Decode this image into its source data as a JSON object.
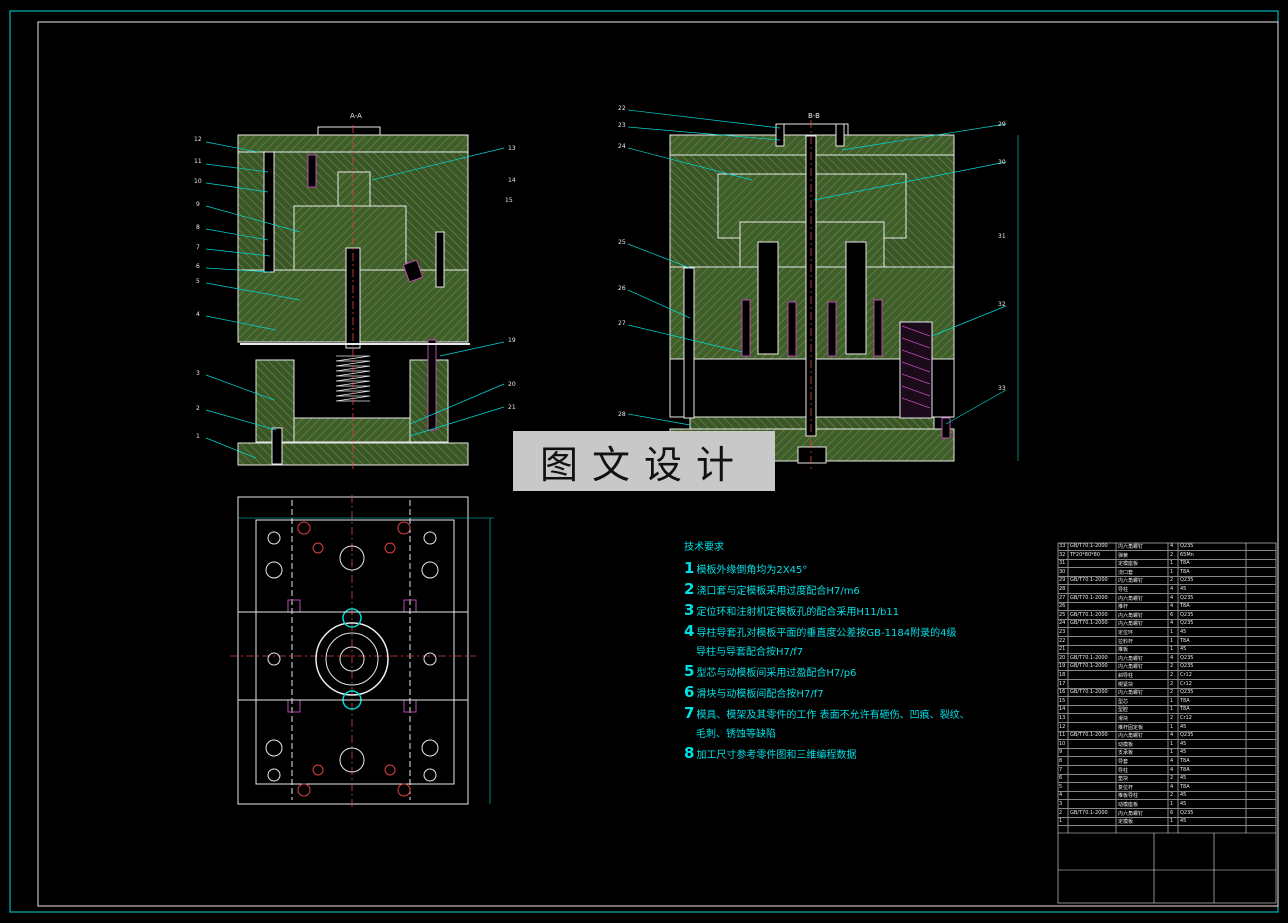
{
  "views": {
    "section_aa_title": "A-A",
    "section_bb_title": "B-B"
  },
  "left_callouts": [
    "12",
    "11",
    "10",
    "9",
    "8",
    "7",
    "6",
    "5",
    "4",
    "3",
    "2",
    "1",
    "13",
    "14",
    "15",
    "19",
    "20",
    "21"
  ],
  "right_callouts": [
    "22",
    "23",
    "24",
    "25",
    "26",
    "27",
    "28",
    "29",
    "30",
    "31",
    "32",
    "33"
  ],
  "watermark": "图文设计",
  "technical_requirements": {
    "title": "技术要求",
    "items": [
      {
        "num": "1",
        "text": "模板外缘倒角均为2X45°"
      },
      {
        "num": "2",
        "text": "浇口套与定模板采用过度配合H7/m6"
      },
      {
        "num": "3",
        "text": "定位环和注射机定模板孔的配合采用H11/b11"
      },
      {
        "num": "4",
        "text": "导柱导套孔对模板平面的垂直度公差按GB-1184附录的4级"
      },
      {
        "num": "",
        "text": "导柱与导套配合按H7/f7"
      },
      {
        "num": "5",
        "text": "型芯与动模板间采用过盈配合H7/p6"
      },
      {
        "num": "6",
        "text": "滑块与动模板间配合按H7/f7"
      },
      {
        "num": "7",
        "text": "模具、模架及其零件的工作 表面不允许有砸伤、凹痕、裂纹、"
      },
      {
        "num": "",
        "text": "毛刺、锈蚀等缺陷"
      },
      {
        "num": "8",
        "text": "加工尺寸参考零件图和三维编程数据"
      }
    ]
  },
  "bom": [
    {
      "no": "33",
      "std": "GB/T70.1-2000",
      "name": "内六角螺钉",
      "qty": "4",
      "mat": "Q235"
    },
    {
      "no": "32",
      "std": "TF20*80*80",
      "name": "弹簧",
      "qty": "2",
      "mat": "65Mn"
    },
    {
      "no": "31",
      "std": "",
      "name": "定模座板",
      "qty": "1",
      "mat": "T8A"
    },
    {
      "no": "30",
      "std": "",
      "name": "浇口套",
      "qty": "1",
      "mat": "T8A"
    },
    {
      "no": "29",
      "std": "GB/T70.1-2000",
      "name": "内六角螺钉",
      "qty": "2",
      "mat": "Q235"
    },
    {
      "no": "28",
      "std": "",
      "name": "导柱",
      "qty": "4",
      "mat": "45"
    },
    {
      "no": "27",
      "std": "GB/T70.1-2000",
      "name": "内六角螺钉",
      "qty": "4",
      "mat": "Q235"
    },
    {
      "no": "26",
      "std": "",
      "name": "推杆",
      "qty": "4",
      "mat": "T8A"
    },
    {
      "no": "25",
      "std": "GB/T70.1-2000",
      "name": "内六角螺钉",
      "qty": "6",
      "mat": "Q235"
    },
    {
      "no": "24",
      "std": "GB/T70.1-2000",
      "name": "内六角螺钉",
      "qty": "4",
      "mat": "Q235"
    },
    {
      "no": "23",
      "std": "",
      "name": "定位环",
      "qty": "1",
      "mat": "45"
    },
    {
      "no": "22",
      "std": "",
      "name": "拉料杆",
      "qty": "1",
      "mat": "T8A"
    },
    {
      "no": "21",
      "std": "",
      "name": "推板",
      "qty": "1",
      "mat": "45"
    },
    {
      "no": "20",
      "std": "GB/T70.1-2000",
      "name": "内六角螺钉",
      "qty": "4",
      "mat": "Q235"
    },
    {
      "no": "19",
      "std": "GB/T70.1-2000",
      "name": "内六角螺钉",
      "qty": "2",
      "mat": "Q235"
    },
    {
      "no": "18",
      "std": "",
      "name": "斜导柱",
      "qty": "2",
      "mat": "Cr12"
    },
    {
      "no": "17",
      "std": "",
      "name": "楔紧块",
      "qty": "2",
      "mat": "Cr12"
    },
    {
      "no": "16",
      "std": "GB/T70.1-2000",
      "name": "内六角螺钉",
      "qty": "2",
      "mat": "Q235"
    },
    {
      "no": "15",
      "std": "",
      "name": "型芯",
      "qty": "1",
      "mat": "T8A"
    },
    {
      "no": "14",
      "std": "",
      "name": "型腔",
      "qty": "1",
      "mat": "T8A"
    },
    {
      "no": "13",
      "std": "",
      "name": "滑块",
      "qty": "2",
      "mat": "Cr12"
    },
    {
      "no": "12",
      "std": "",
      "name": "推杆固定板",
      "qty": "1",
      "mat": "45"
    },
    {
      "no": "11",
      "std": "GB/T70.1-2000",
      "name": "内六角螺钉",
      "qty": "4",
      "mat": "Q235"
    },
    {
      "no": "10",
      "std": "",
      "name": "动模板",
      "qty": "1",
      "mat": "45"
    },
    {
      "no": "9",
      "std": "",
      "name": "支承板",
      "qty": "1",
      "mat": "45"
    },
    {
      "no": "8",
      "std": "",
      "name": "导套",
      "qty": "4",
      "mat": "T8A"
    },
    {
      "no": "7",
      "std": "",
      "name": "导柱",
      "qty": "4",
      "mat": "T8A"
    },
    {
      "no": "6",
      "std": "",
      "name": "垫块",
      "qty": "2",
      "mat": "45"
    },
    {
      "no": "5",
      "std": "",
      "name": "复位杆",
      "qty": "4",
      "mat": "T8A"
    },
    {
      "no": "4",
      "std": "",
      "name": "推板导柱",
      "qty": "2",
      "mat": "45"
    },
    {
      "no": "3",
      "std": "",
      "name": "动模座板",
      "qty": "1",
      "mat": "45"
    },
    {
      "no": "2",
      "std": "GB/T70.1-2000",
      "name": "内六角螺钉",
      "qty": "6",
      "mat": "Q235"
    },
    {
      "no": "1",
      "std": "",
      "name": "定模板",
      "qty": "1",
      "mat": "45"
    }
  ],
  "colors": {
    "background": "#000000",
    "border": "#00d8d8",
    "plate_fill": "#3f5e2a",
    "hatch": "#71904f",
    "outline": "#e8e8e8",
    "centerline": "#e04040",
    "screw": "#c04ab0",
    "text_cyan": "#00e0e6",
    "watermark_bg": "#c8c8c8"
  }
}
